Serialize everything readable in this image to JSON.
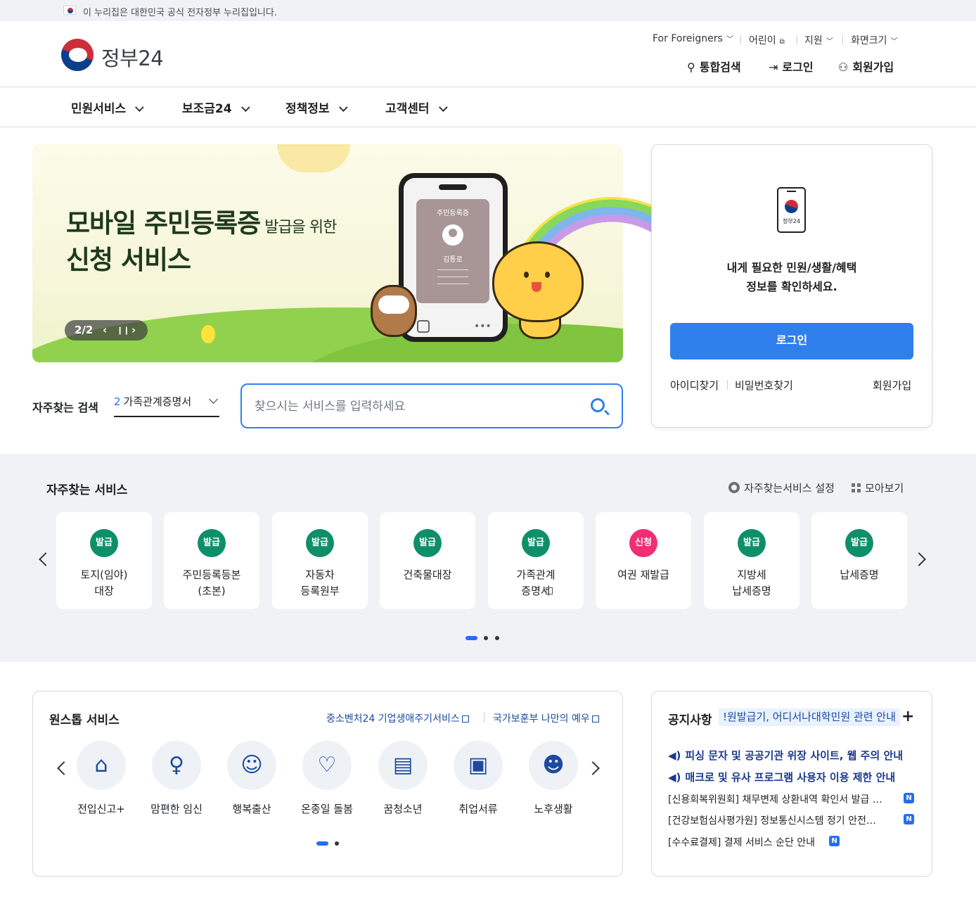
{
  "gov_strip": {
    "text": "이 누리집은 대한민국 공식 전자정부 누리집입니다."
  },
  "header": {
    "logo_text": "정부24",
    "util": {
      "foreigners": "For Foreigners",
      "kids": "어린이",
      "support": "지원",
      "font_size": "화면크기"
    },
    "actions": {
      "search": "통합검색",
      "login": "로그인",
      "join": "회원가입"
    }
  },
  "gnb": [
    "민원서비스",
    "보조금24",
    "정책정보",
    "고객센터"
  ],
  "banner": {
    "title_bold": "모바일 주민등록증",
    "title_small": "발급을 위한",
    "title_line2": "신청 서비스",
    "counter": "2/2",
    "card_title": "주민등록증",
    "card_name": "김통로"
  },
  "login_panel": {
    "logo_label": "정부24",
    "message_line1": "내게 필요한 민원/생활/혜택",
    "message_line2": "정보를 확인하세요.",
    "button": "로그인",
    "find_id": "아이디찾기",
    "find_pw": "비밀번호찾기",
    "join": "회원가입"
  },
  "search": {
    "label": "자주찾는 검색",
    "select_num": "2",
    "select_value": "가족관계증명서",
    "placeholder": "찾으시는 서비스를 입력하세요"
  },
  "frequent": {
    "title": "자주찾는 서비스",
    "settings": "자주찾는서비스 설정",
    "view_all": "모아보기",
    "cards": [
      {
        "badge": "발급",
        "label": "토지(임야)\n대장"
      },
      {
        "badge": "발급",
        "label": "주민등록등본\n(초본)"
      },
      {
        "badge": "발급",
        "label": "자동차\n등록원부"
      },
      {
        "badge": "발급",
        "label": "건축물대장"
      },
      {
        "badge": "발급",
        "label": "가족관계\n증명서"
      },
      {
        "badge": "신청",
        "label": "여권 재발급"
      },
      {
        "badge": "발급",
        "label": "지방세\n납세증명"
      },
      {
        "badge": "발급",
        "label": "납세증명"
      }
    ],
    "colors": {
      "issue": "#0e8f6a",
      "apply": "#ef2e73"
    }
  },
  "onestop": {
    "title": "원스톱 서비스",
    "link1": "중소벤처24 기업생애주기서비스",
    "link2": "국가보훈부 나만의 예우",
    "items": [
      {
        "icon": "house-icon",
        "label": "전입신고+"
      },
      {
        "icon": "pregnant-icon",
        "label": "맘편한 임신"
      },
      {
        "icon": "baby-icon",
        "label": "행복출산"
      },
      {
        "icon": "ribbon-icon",
        "label": "온종일 돌봄"
      },
      {
        "icon": "book-icon",
        "label": "꿈청소년"
      },
      {
        "icon": "briefcase-icon",
        "label": "취업서류"
      },
      {
        "icon": "elder-icon",
        "label": "노후생활"
      }
    ]
  },
  "notice": {
    "title": "공지사항",
    "highlight": "!원발급기, 어디서나대학민원 관련 안내",
    "important": [
      "피싱 문자 및 공공기관 위장 사이트, 웹 주의 안내",
      "매크로 및 유사 프로그램 사용자 이용 제한 안내"
    ],
    "items": [
      "[신용회복위원회] 채무변제 상환내역 확인서 발급 …",
      "[건강보험심사평가원] 정보통신시스템 정기 안전…",
      "[수수료결제] 결제 서비스 순단 안내"
    ],
    "new_badge": "N"
  }
}
